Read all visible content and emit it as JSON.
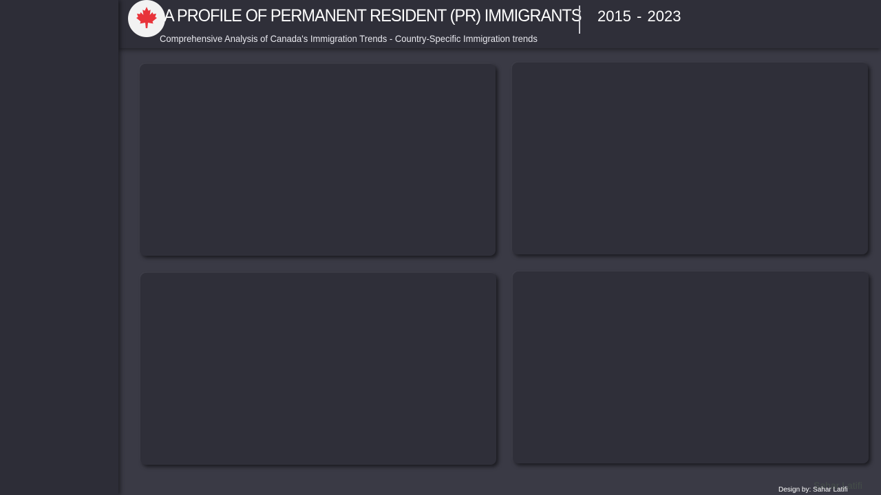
{
  "header": {
    "title": "A PROFILE OF PERMANENT RESIDENT (PR) IMMIGRANTS",
    "years": "2015 - 2023",
    "subtitle": "Comprehensive Analysis of Canada's Immigration Trends - Country-Specific Immigration trends",
    "logo_icon": "maple-leaf-icon",
    "logo_color": "#e8333a"
  },
  "footer": {
    "credit": "Design by: Sahar Latifi",
    "watermark": "Sahar Latifi"
  },
  "colors": {
    "background": "#3a3a45",
    "sidebar": "#2d2d37",
    "panel": "#2f2f39",
    "text": "#ffffff"
  }
}
